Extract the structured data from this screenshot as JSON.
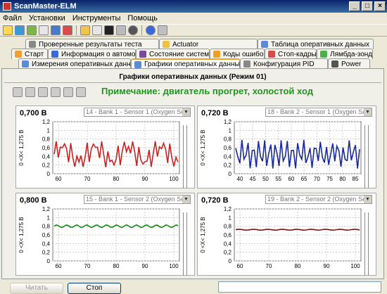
{
  "window": {
    "title": "ScanMaster-ELM",
    "min": "_",
    "max": "□",
    "close": "×"
  },
  "menu": [
    "Файл",
    "Установки",
    "Инструменты",
    "Помощь"
  ],
  "tabs": {
    "row1": [
      "Проверенные результаты теста",
      "Actuator",
      "Таблица оперативных данных"
    ],
    "row2": [
      "Старт",
      "Информация о автомобиле",
      "Состояние системы",
      "Коды ошибок",
      "Стоп-кадры",
      "Лямбда-зонды"
    ],
    "row3": [
      "Измерения оперативных данных",
      "Графики оперативных данных",
      "Конфигурация PID",
      "Power"
    ]
  },
  "panel": {
    "title": "Графики оперативных данных (Режим 01)",
    "note": "Примечание: двигатель прогрет, холостой ход"
  },
  "charts": [
    {
      "value": "0,700 В",
      "color": "#cc2222",
      "sensor": "14 - Bank 1 - Sensor 1 (Oxygen Senso",
      "ylabel": "0 <X< 1,275 В",
      "yticks": [
        "1,2",
        "1",
        "0,8",
        "0,6",
        "0,4",
        "0,2",
        "0"
      ],
      "xticks": [
        "60",
        "70",
        "80",
        "90",
        "100"
      ]
    },
    {
      "value": "0,720 В",
      "color": "#1a2a9a",
      "sensor": "18 - Bank 2 - Sensor 1 (Oxygen Senso",
      "ylabel": "0 <X< 1,275 В",
      "yticks": [
        "1,2",
        "1",
        "0,8",
        "0,6",
        "0,4",
        "0,2",
        "0"
      ],
      "xticks": [
        "40",
        "45",
        "50",
        "55",
        "60",
        "65",
        "70",
        "75",
        "80",
        "85"
      ]
    },
    {
      "value": "0,800 В",
      "color": "#1a8a1a",
      "sensor": "15 - Bank 1 - Sensor 2 (Oxygen Senso",
      "ylabel": "0 <X< 1,275 В",
      "yticks": [
        "1,2",
        "1",
        "0,8",
        "0,6",
        "0,4",
        "0,2",
        "0"
      ],
      "xticks": [
        "60",
        "70",
        "80",
        "90",
        "100"
      ]
    },
    {
      "value": "0,720 В",
      "color": "#7a1010",
      "sensor": "19 - Bank 2 - Sensor 2 (Oxygen Senso",
      "ylabel": "0 <X< 1,275 В",
      "yticks": [
        "1,2",
        "1",
        "0,8",
        "0,6",
        "0,4",
        "0,2",
        "0"
      ],
      "xticks": [
        "60",
        "70",
        "80",
        "90",
        "100"
      ]
    }
  ],
  "buttons": {
    "read": "Читать",
    "stop": "Стоп"
  }
}
